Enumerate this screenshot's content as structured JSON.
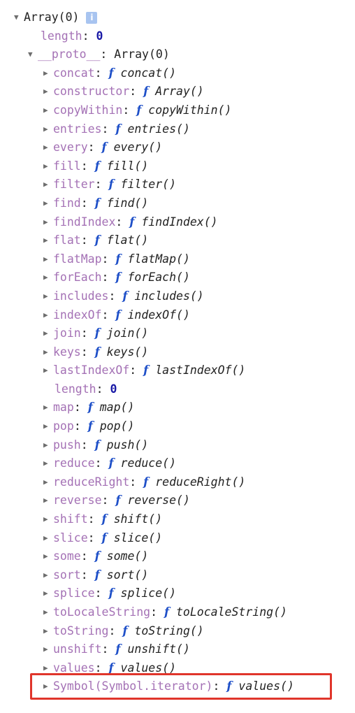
{
  "root": {
    "label": "Array(0)",
    "expanded": true,
    "info_icon": "info-icon",
    "length_key": "length",
    "length_value": "0",
    "proto": {
      "key": "__proto__",
      "value": "Array(0)",
      "expanded": true,
      "members": [
        {
          "key": "concat",
          "type": "function",
          "fn": "concat()"
        },
        {
          "key": "constructor",
          "type": "function",
          "fn": "Array()"
        },
        {
          "key": "copyWithin",
          "type": "function",
          "fn": "copyWithin()"
        },
        {
          "key": "entries",
          "type": "function",
          "fn": "entries()"
        },
        {
          "key": "every",
          "type": "function",
          "fn": "every()"
        },
        {
          "key": "fill",
          "type": "function",
          "fn": "fill()"
        },
        {
          "key": "filter",
          "type": "function",
          "fn": "filter()"
        },
        {
          "key": "find",
          "type": "function",
          "fn": "find()"
        },
        {
          "key": "findIndex",
          "type": "function",
          "fn": "findIndex()"
        },
        {
          "key": "flat",
          "type": "function",
          "fn": "flat()"
        },
        {
          "key": "flatMap",
          "type": "function",
          "fn": "flatMap()"
        },
        {
          "key": "forEach",
          "type": "function",
          "fn": "forEach()"
        },
        {
          "key": "includes",
          "type": "function",
          "fn": "includes()"
        },
        {
          "key": "indexOf",
          "type": "function",
          "fn": "indexOf()"
        },
        {
          "key": "join",
          "type": "function",
          "fn": "join()"
        },
        {
          "key": "keys",
          "type": "function",
          "fn": "keys()"
        },
        {
          "key": "lastIndexOf",
          "type": "function",
          "fn": "lastIndexOf()"
        },
        {
          "key": "length",
          "type": "number",
          "value": "0"
        },
        {
          "key": "map",
          "type": "function",
          "fn": "map()"
        },
        {
          "key": "pop",
          "type": "function",
          "fn": "pop()"
        },
        {
          "key": "push",
          "type": "function",
          "fn": "push()"
        },
        {
          "key": "reduce",
          "type": "function",
          "fn": "reduce()"
        },
        {
          "key": "reduceRight",
          "type": "function",
          "fn": "reduceRight()"
        },
        {
          "key": "reverse",
          "type": "function",
          "fn": "reverse()"
        },
        {
          "key": "shift",
          "type": "function",
          "fn": "shift()"
        },
        {
          "key": "slice",
          "type": "function",
          "fn": "slice()"
        },
        {
          "key": "some",
          "type": "function",
          "fn": "some()"
        },
        {
          "key": "sort",
          "type": "function",
          "fn": "sort()"
        },
        {
          "key": "splice",
          "type": "function",
          "fn": "splice()"
        },
        {
          "key": "toLocaleString",
          "type": "function",
          "fn": "toLocaleString()"
        },
        {
          "key": "toString",
          "type": "function",
          "fn": "toString()"
        },
        {
          "key": "unshift",
          "type": "function",
          "fn": "unshift()"
        },
        {
          "key": "values",
          "type": "function",
          "fn": "values()"
        },
        {
          "key": "Symbol(Symbol.iterator)",
          "type": "function",
          "fn": "values()",
          "highlighted": true
        }
      ]
    }
  },
  "glyphs": {
    "expanded": "▼",
    "collapsed": "▶",
    "function": "f",
    "colon": ":",
    "info": "i"
  },
  "colors": {
    "key": "#a471b5",
    "number": "#1a1aa6",
    "function_marker": "#1f50c8",
    "highlight_border": "#e0352b",
    "info_badge": "#a8c4f0"
  }
}
